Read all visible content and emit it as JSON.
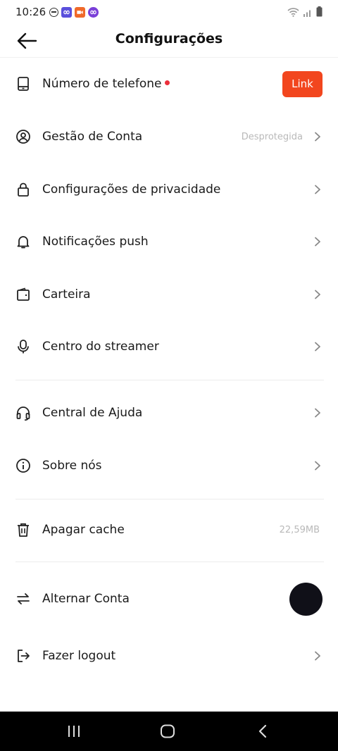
{
  "status_bar": {
    "time": "10:26"
  },
  "header": {
    "title": "Configurações"
  },
  "rows": [
    {
      "label": "Número de telefone",
      "icon": "phone-icon",
      "button": "Link"
    },
    {
      "label": "Gestão de Conta",
      "icon": "account-icon",
      "value": "Desprotegida"
    },
    {
      "label": "Configurações de privacidade",
      "icon": "lock-icon"
    },
    {
      "label": "Notificações push",
      "icon": "bell-icon"
    },
    {
      "label": "Carteira",
      "icon": "wallet-icon"
    },
    {
      "label": "Centro do streamer",
      "icon": "microphone-icon"
    },
    {
      "label": "Central de Ajuda",
      "icon": "headset-icon"
    },
    {
      "label": "Sobre nós",
      "icon": "info-icon"
    },
    {
      "label": "Apagar cache",
      "icon": "trash-icon",
      "value": "22,59MB"
    },
    {
      "label": "Alternar Conta",
      "icon": "swap-icon"
    },
    {
      "label": "Fazer logout",
      "icon": "logout-icon"
    }
  ],
  "colors": {
    "accent": "#f2461e",
    "notification_dot": "#ec2f3b"
  }
}
